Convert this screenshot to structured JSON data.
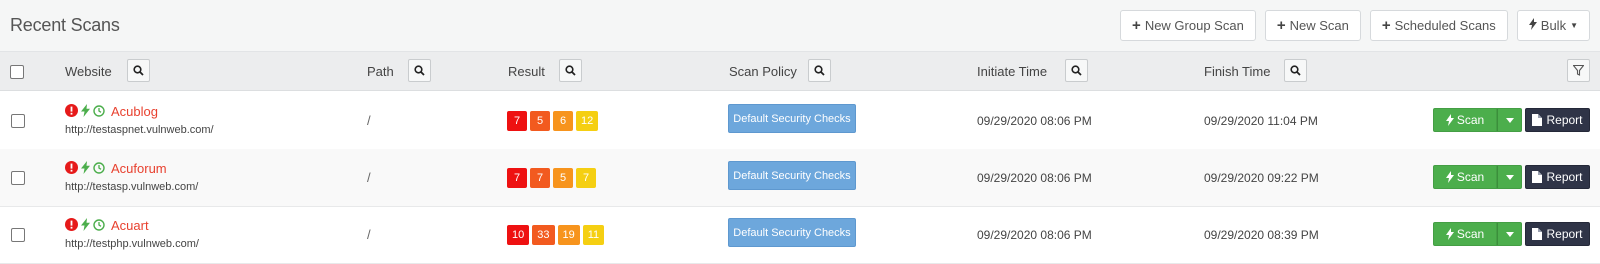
{
  "header": {
    "title": "Recent Scans",
    "buttons": {
      "new_group_scan": "New Group Scan",
      "new_scan": "New Scan",
      "scheduled_scans": "Scheduled Scans",
      "bulk": "Bulk"
    }
  },
  "table": {
    "columns": {
      "website": "Website",
      "path": "Path",
      "result": "Result",
      "scan_policy": "Scan Policy",
      "initiate_time": "Initiate Time",
      "finish_time": "Finish Time"
    },
    "rows": [
      {
        "name": "Acublog",
        "url": "http://testaspnet.vulnweb.com/",
        "path": "/",
        "counts": [
          "7",
          "5",
          "6",
          "12"
        ],
        "policy": "Default Security Checks",
        "initiate_time": "09/29/2020 08:06 PM",
        "finish_time": "09/29/2020 11:04 PM",
        "scan_label": "Scan",
        "report_label": "Report"
      },
      {
        "name": "Acuforum",
        "url": "http://testasp.vulnweb.com/",
        "path": "/",
        "counts": [
          "7",
          "7",
          "5",
          "7"
        ],
        "policy": "Default Security Checks",
        "initiate_time": "09/29/2020 08:06 PM",
        "finish_time": "09/29/2020 09:22 PM",
        "scan_label": "Scan",
        "report_label": "Report"
      },
      {
        "name": "Acuart",
        "url": "http://testphp.vulnweb.com/",
        "path": "/",
        "counts": [
          "10",
          "33",
          "19",
          "11"
        ],
        "policy": "Default Security Checks",
        "initiate_time": "09/29/2020 08:06 PM",
        "finish_time": "09/29/2020 08:39 PM",
        "scan_label": "Scan",
        "report_label": "Report"
      }
    ]
  },
  "colors": {
    "critical": "#ee1111",
    "high": "#f25a1f",
    "medium": "#f7941d",
    "low": "#f5cf12",
    "scan_green": "#4cae4c",
    "report_dark": "#2f3447",
    "policy_blue": "#6da7dc",
    "link_red": "#e8412f"
  },
  "icons": {
    "status": [
      "exclamation-circle-icon",
      "bolt-icon",
      "clock-icon"
    ],
    "search": "search-icon",
    "filter": "filter-icon"
  }
}
